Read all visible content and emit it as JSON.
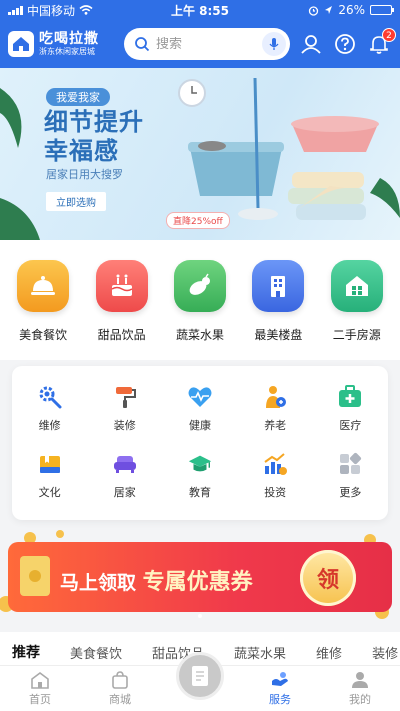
{
  "status_bar": {
    "carrier": "中国移动",
    "time": "上午 8:55",
    "battery": "26%",
    "battery_level": 0.26
  },
  "header": {
    "logo_name": "吃喝拉撒",
    "logo_sub": "浙东休闲家居城",
    "search_placeholder": "搜索",
    "notification_count": "2"
  },
  "banner": {
    "tag": "我爱我家",
    "title_line1": "细节提升",
    "title_line2": "幸福感",
    "desc": "居家日用大搜罗",
    "button": "立即选购",
    "discount": "直降25%off"
  },
  "categories": [
    {
      "label": "美食餐饮",
      "icon": "cloche-icon",
      "color": "#f7b23b"
    },
    {
      "label": "甜品饮品",
      "icon": "cake-icon",
      "color": "#f25b5b"
    },
    {
      "label": "蔬菜水果",
      "icon": "vegetable-icon",
      "color": "#4cc26a"
    },
    {
      "label": "最美楼盘",
      "icon": "building-icon",
      "color": "#4d7cf0"
    },
    {
      "label": "二手房源",
      "icon": "house-icon",
      "color": "#36c28a"
    }
  ],
  "services": [
    {
      "label": "维修",
      "icon": "wrench-gear-icon"
    },
    {
      "label": "装修",
      "icon": "paint-roller-icon"
    },
    {
      "label": "健康",
      "icon": "heart-pulse-icon"
    },
    {
      "label": "养老",
      "icon": "elder-icon"
    },
    {
      "label": "医疗",
      "icon": "medical-kit-icon"
    },
    {
      "label": "文化",
      "icon": "book-icon"
    },
    {
      "label": "居家",
      "icon": "sofa-icon"
    },
    {
      "label": "教育",
      "icon": "graduation-cap-icon"
    },
    {
      "label": "投资",
      "icon": "chart-icon"
    },
    {
      "label": "更多",
      "icon": "more-grid-icon"
    }
  ],
  "coupon": {
    "text_prefix": "马上领取",
    "text_main": "专属优惠券",
    "button": "领"
  },
  "tabs": [
    "推荐",
    "美食餐饮",
    "甜品饮品",
    "蔬菜水果",
    "维修",
    "装修"
  ],
  "nav": [
    {
      "label": "首页",
      "icon": "home-icon"
    },
    {
      "label": "商城",
      "icon": "shop-bag-icon"
    },
    {
      "label": "服务",
      "icon": "service-icon"
    },
    {
      "label": "我的",
      "icon": "profile-icon"
    }
  ],
  "colors": {
    "primary": "#2f6fe6",
    "coupon": "#f0394b"
  }
}
